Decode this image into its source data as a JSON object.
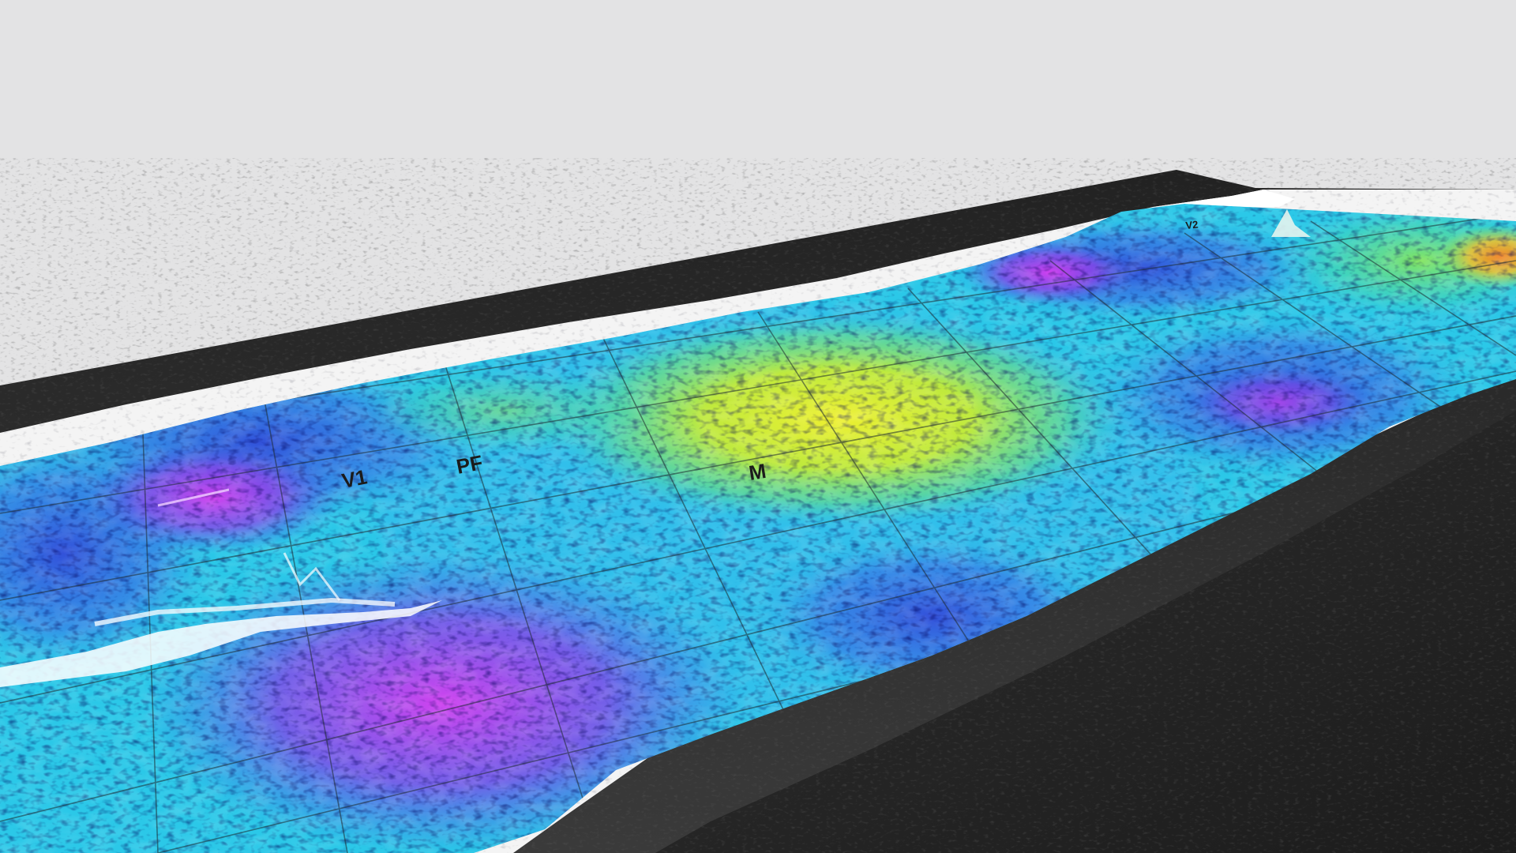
{
  "map": {
    "feature_labels": {
      "v1": "V1",
      "pf": "PF",
      "m": "M",
      "v2": "V2"
    },
    "colors": {
      "background": "#e3e3e4",
      "base_slab": "#2a2a2a",
      "border": "#f4f4f4",
      "low_elevation": "#c33be6",
      "mid_low_elevation": "#3a5be0",
      "mid_elevation": "#2bc8e8",
      "mid_high_elevation": "#7fe860",
      "high_elevation": "#e8ee30",
      "peak_elevation": "#f0a020",
      "grid_lines": "#1e2a30"
    }
  }
}
